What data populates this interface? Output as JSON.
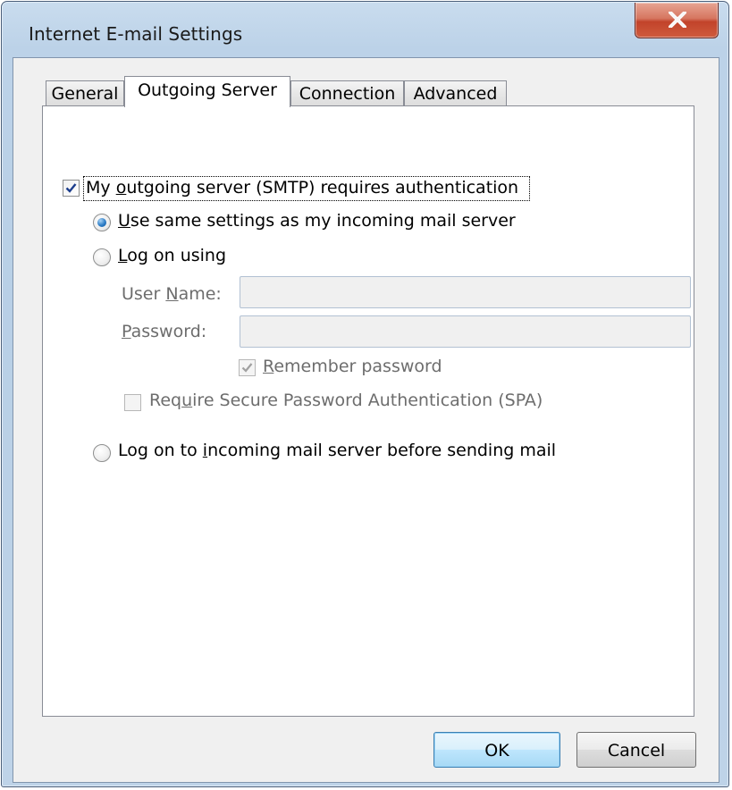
{
  "window": {
    "title": "Internet E-mail Settings",
    "close_symbol": "X"
  },
  "tabs": [
    {
      "label": "General",
      "active": false
    },
    {
      "label": "Outgoing Server",
      "active": true
    },
    {
      "label": "Connection",
      "active": false
    },
    {
      "label": "Advanced",
      "active": false
    }
  ],
  "outgoing": {
    "smtp_auth": {
      "label_prefix": "My ",
      "label_mnemonic": "o",
      "label_suffix": "utgoing server (SMTP) requires authentication",
      "checked": true
    },
    "options": {
      "same_settings": {
        "mnemonic": "U",
        "rest": "se same settings as my incoming mail server",
        "selected": true
      },
      "log_on_using": {
        "mnemonic": "L",
        "rest": "og on using",
        "selected": false
      },
      "log_on_incoming": {
        "prefix": "Log on to ",
        "mnemonic": "i",
        "rest": "ncoming mail server before sending mail",
        "selected": false
      }
    },
    "user_name": {
      "prefix": "User ",
      "mnemonic": "N",
      "rest": "ame:",
      "value": ""
    },
    "password": {
      "mnemonic": "P",
      "rest": "assword:",
      "value": ""
    },
    "remember_password": {
      "mnemonic": "R",
      "rest": "emember password",
      "checked": true,
      "enabled": false
    },
    "spa": {
      "prefix": "Req",
      "mnemonic": "u",
      "rest": "ire Secure Password Authentication (SPA)",
      "checked": false,
      "enabled": false
    }
  },
  "buttons": {
    "ok": "OK",
    "cancel": "Cancel"
  },
  "colors": {
    "default_button_border": "#3c7fb1",
    "radio_dot": "#2e7dc6",
    "checkmark": "#1c3d8c",
    "close_button": "#c2432a"
  }
}
